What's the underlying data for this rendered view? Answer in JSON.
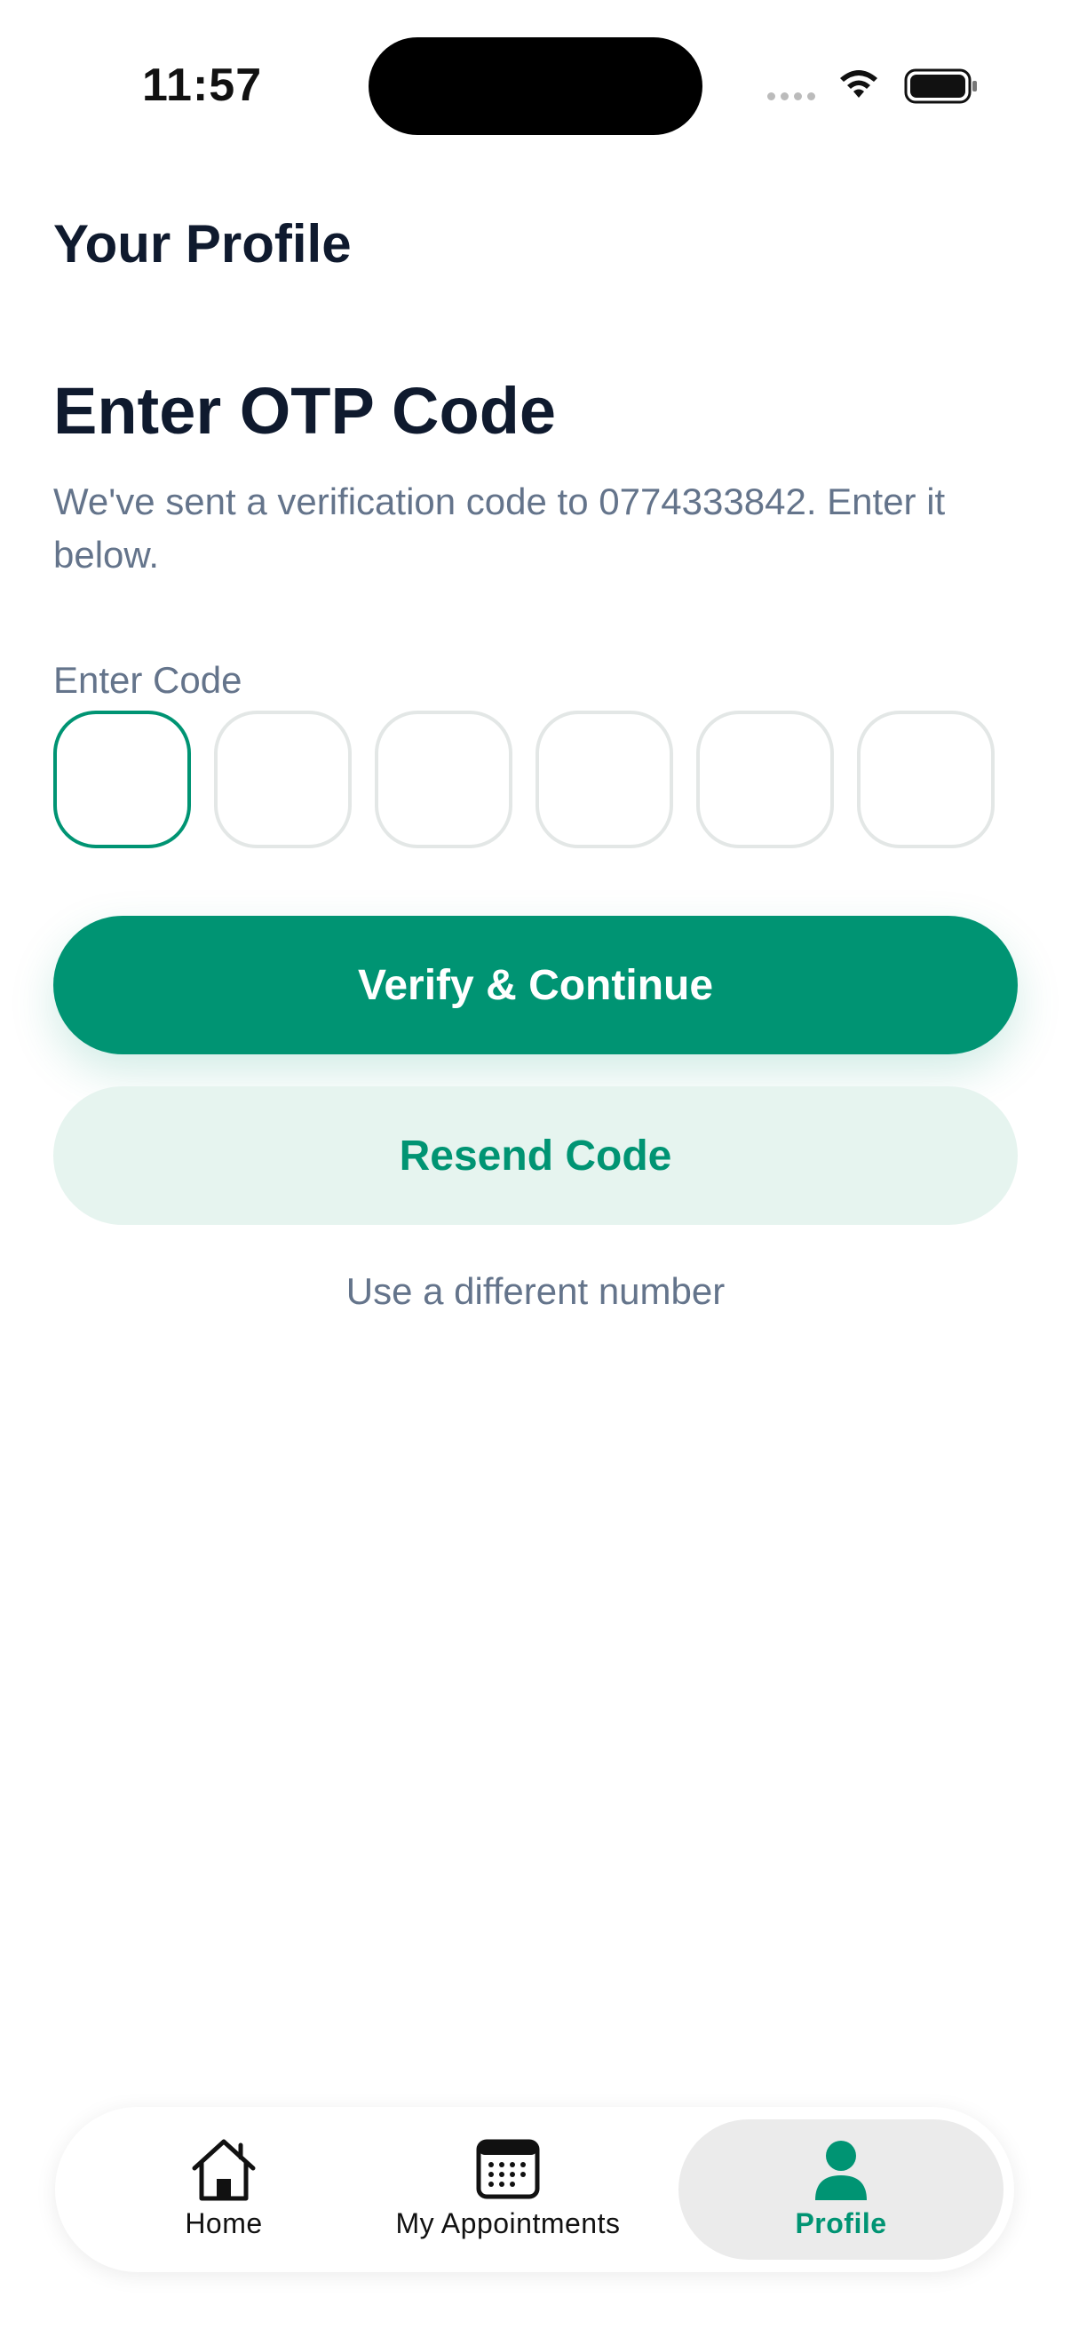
{
  "status_bar": {
    "time": "11:57"
  },
  "header": {
    "title": "Your Profile"
  },
  "otp": {
    "title": "Enter OTP Code",
    "description": "We've sent a verification code to 0774333842. Enter it below.",
    "code_label": "Enter Code",
    "digits": [
      "",
      "",
      "",
      "",
      "",
      ""
    ]
  },
  "actions": {
    "verify_label": "Verify & Continue",
    "resend_label": "Resend Code",
    "different_number_label": "Use a different number"
  },
  "tabbar": {
    "items": [
      {
        "label": "Home",
        "icon": "home-icon"
      },
      {
        "label": "My Appointments",
        "icon": "calendar-icon"
      },
      {
        "label": "Profile",
        "icon": "person-icon",
        "active": true
      }
    ]
  },
  "colors": {
    "accent": "#009473",
    "accent_light": "#e6f4ef",
    "text_dark": "#0f1a2e",
    "text_muted": "#64748b"
  }
}
